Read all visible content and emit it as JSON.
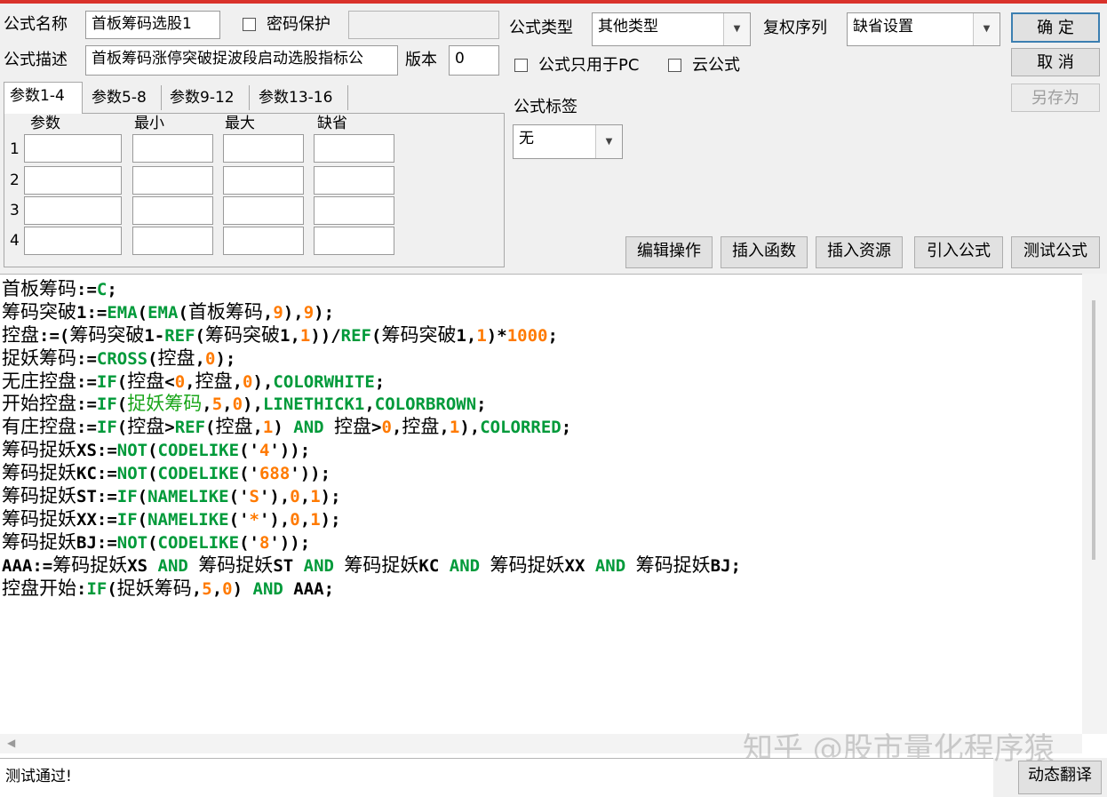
{
  "form": {
    "name_label": "公式名称",
    "name_value": "首板筹码选股1",
    "password_label": "密码保护",
    "password_value": "",
    "desc_label": "公式描述",
    "desc_value": "首板筹码涨停突破捉波段启动选股指标公",
    "version_label": "版本",
    "version_value": "0",
    "type_label": "公式类型",
    "type_value": "其他类型",
    "rights_label": "复权序列",
    "rights_value": "缺省设置",
    "pc_only_label": "公式只用于PC",
    "cloud_label": "云公式",
    "tag_label": "公式标签",
    "tag_value": "无"
  },
  "buttons": {
    "ok": "确  定",
    "cancel": "取  消",
    "save_as": "另存为",
    "edit_ops": "编辑操作",
    "insert_func": "插入函数",
    "insert_res": "插入资源",
    "import_formula": "引入公式",
    "test_formula": "测试公式",
    "dynamic_translate": "动态翻译"
  },
  "tabs": [
    "参数1-4",
    "参数5-8",
    "参数9-12",
    "参数13-16"
  ],
  "params": {
    "headers": [
      "参数",
      "最小",
      "最大",
      "缺省"
    ],
    "rows": [
      "1",
      "2",
      "3",
      "4"
    ]
  },
  "code_lines": [
    [
      [
        "cn",
        "首板筹码"
      ],
      [
        "op",
        ":="
      ],
      [
        "func",
        "C"
      ],
      [
        "op",
        ";"
      ]
    ],
    [
      [
        "cn",
        "筹码突破"
      ],
      [
        "op",
        "1:="
      ],
      [
        "func",
        "EMA"
      ],
      [
        "op",
        "("
      ],
      [
        "func",
        "EMA"
      ],
      [
        "op",
        "("
      ],
      [
        "cn",
        "首板筹码"
      ],
      [
        "op",
        ","
      ],
      [
        "num",
        "9"
      ],
      [
        "op",
        "),"
      ],
      [
        "num",
        "9"
      ],
      [
        "op",
        ");"
      ]
    ],
    [
      [
        "cn",
        "控盘"
      ],
      [
        "op",
        ":=("
      ],
      [
        "cn",
        "筹码突破"
      ],
      [
        "op",
        "1-"
      ],
      [
        "func",
        "REF"
      ],
      [
        "op",
        "("
      ],
      [
        "cn",
        "筹码突破"
      ],
      [
        "op",
        "1,"
      ],
      [
        "num",
        "1"
      ],
      [
        "op",
        "))/"
      ],
      [
        "func",
        "REF"
      ],
      [
        "op",
        "("
      ],
      [
        "cn",
        "筹码突破"
      ],
      [
        "op",
        "1,"
      ],
      [
        "num",
        "1"
      ],
      [
        "op",
        ")*"
      ],
      [
        "num",
        "1000"
      ],
      [
        "op",
        ";"
      ]
    ],
    [
      [
        "cn",
        "捉妖筹码"
      ],
      [
        "op",
        ":="
      ],
      [
        "func",
        "CROSS"
      ],
      [
        "op",
        "("
      ],
      [
        "cn",
        "控盘"
      ],
      [
        "op",
        ","
      ],
      [
        "num",
        "0"
      ],
      [
        "op",
        ");"
      ]
    ],
    [
      [
        "cn",
        "无庄控盘"
      ],
      [
        "op",
        ":="
      ],
      [
        "func",
        "IF"
      ],
      [
        "op",
        "("
      ],
      [
        "cn",
        "控盘"
      ],
      [
        "op",
        "<"
      ],
      [
        "num",
        "0"
      ],
      [
        "op",
        ","
      ],
      [
        "cn",
        "控盘"
      ],
      [
        "op",
        ","
      ],
      [
        "num",
        "0"
      ],
      [
        "op",
        "),"
      ],
      [
        "func",
        "COLORWHITE"
      ],
      [
        "op",
        ";"
      ]
    ],
    [
      [
        "cn",
        "开始控盘"
      ],
      [
        "op",
        ":="
      ],
      [
        "func",
        "IF"
      ],
      [
        "op",
        "("
      ],
      [
        "gcn",
        "捉妖筹码"
      ],
      [
        "op",
        ","
      ],
      [
        "num",
        "5"
      ],
      [
        "op",
        ","
      ],
      [
        "num",
        "0"
      ],
      [
        "op",
        "),"
      ],
      [
        "func",
        "LINETHICK1"
      ],
      [
        "op",
        ","
      ],
      [
        "func",
        "COLORBROWN"
      ],
      [
        "op",
        ";"
      ]
    ],
    [
      [
        "cn",
        "有庄控盘"
      ],
      [
        "op",
        ":="
      ],
      [
        "func",
        "IF"
      ],
      [
        "op",
        "("
      ],
      [
        "cn",
        "控盘"
      ],
      [
        "op",
        ">"
      ],
      [
        "func",
        "REF"
      ],
      [
        "op",
        "("
      ],
      [
        "cn",
        "控盘"
      ],
      [
        "op",
        ","
      ],
      [
        "num",
        "1"
      ],
      [
        "op",
        ") "
      ],
      [
        "func",
        "AND"
      ],
      [
        "op",
        " "
      ],
      [
        "cn",
        "控盘"
      ],
      [
        "op",
        ">"
      ],
      [
        "num",
        "0"
      ],
      [
        "op",
        ","
      ],
      [
        "cn",
        "控盘"
      ],
      [
        "op",
        ","
      ],
      [
        "num",
        "1"
      ],
      [
        "op",
        "),"
      ],
      [
        "func",
        "COLORRED"
      ],
      [
        "op",
        ";"
      ]
    ],
    [
      [
        "cn",
        "筹码捉妖"
      ],
      [
        "op",
        "XS:="
      ],
      [
        "func",
        "NOT"
      ],
      [
        "op",
        "("
      ],
      [
        "func",
        "CODELIKE"
      ],
      [
        "op",
        "('"
      ],
      [
        "str",
        "4"
      ],
      [
        "op",
        "'));"
      ]
    ],
    [
      [
        "cn",
        "筹码捉妖"
      ],
      [
        "op",
        "KC:="
      ],
      [
        "func",
        "NOT"
      ],
      [
        "op",
        "("
      ],
      [
        "func",
        "CODELIKE"
      ],
      [
        "op",
        "('"
      ],
      [
        "str",
        "688"
      ],
      [
        "op",
        "'));"
      ]
    ],
    [
      [
        "cn",
        "筹码捉妖"
      ],
      [
        "op",
        "ST:="
      ],
      [
        "func",
        "IF"
      ],
      [
        "op",
        "("
      ],
      [
        "func",
        "NAMELIKE"
      ],
      [
        "op",
        "('"
      ],
      [
        "str",
        "S"
      ],
      [
        "op",
        "'),"
      ],
      [
        "num",
        "0"
      ],
      [
        "op",
        ","
      ],
      [
        "num",
        "1"
      ],
      [
        "op",
        ");"
      ]
    ],
    [
      [
        "cn",
        "筹码捉妖"
      ],
      [
        "op",
        "XX:="
      ],
      [
        "func",
        "IF"
      ],
      [
        "op",
        "("
      ],
      [
        "func",
        "NAMELIKE"
      ],
      [
        "op",
        "('"
      ],
      [
        "str",
        "*"
      ],
      [
        "op",
        "'),"
      ],
      [
        "num",
        "0"
      ],
      [
        "op",
        ","
      ],
      [
        "num",
        "1"
      ],
      [
        "op",
        ");"
      ]
    ],
    [
      [
        "cn",
        "筹码捉妖"
      ],
      [
        "op",
        "BJ:="
      ],
      [
        "func",
        "NOT"
      ],
      [
        "op",
        "("
      ],
      [
        "func",
        "CODELIKE"
      ],
      [
        "op",
        "('"
      ],
      [
        "str",
        "8"
      ],
      [
        "op",
        "'));"
      ]
    ],
    [
      [
        "op",
        "AAA:="
      ],
      [
        "cn",
        "筹码捉妖"
      ],
      [
        "op",
        "XS "
      ],
      [
        "func",
        "AND"
      ],
      [
        "op",
        " "
      ],
      [
        "cn",
        "筹码捉妖"
      ],
      [
        "op",
        "ST "
      ],
      [
        "func",
        "AND"
      ],
      [
        "op",
        " "
      ],
      [
        "cn",
        "筹码捉妖"
      ],
      [
        "op",
        "KC "
      ],
      [
        "func",
        "AND"
      ],
      [
        "op",
        " "
      ],
      [
        "cn",
        "筹码捉妖"
      ],
      [
        "op",
        "XX "
      ],
      [
        "func",
        "AND"
      ],
      [
        "op",
        " "
      ],
      [
        "cn",
        "筹码捉妖"
      ],
      [
        "op",
        "BJ;"
      ]
    ],
    [
      [
        "cn",
        "控盘开始"
      ],
      [
        "op",
        ":"
      ],
      [
        "func",
        "IF"
      ],
      [
        "op",
        "("
      ],
      [
        "cn",
        "捉妖筹码"
      ],
      [
        "op",
        ","
      ],
      [
        "num",
        "5"
      ],
      [
        "op",
        ","
      ],
      [
        "num",
        "0"
      ],
      [
        "op",
        ") "
      ],
      [
        "func",
        "AND"
      ],
      [
        "op",
        " AAA;"
      ]
    ]
  ],
  "status_text": "测试通过!",
  "watermark": "知乎 @股市量化程序猿",
  "colors": {
    "function": "#009a3a",
    "number": "#ff7a00",
    "highlight_cn": "#19a519",
    "top_accent": "#d9322b"
  }
}
